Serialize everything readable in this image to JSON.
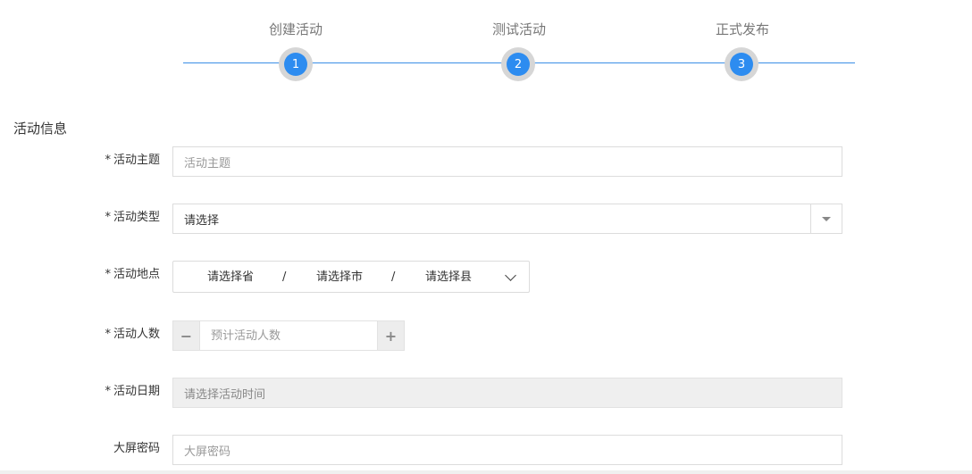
{
  "stepper": {
    "steps": [
      {
        "label": "创建活动",
        "number": "1"
      },
      {
        "label": "测试活动",
        "number": "2"
      },
      {
        "label": "正式发布",
        "number": "3"
      }
    ],
    "accent_color": "#2d8cf0"
  },
  "section_title": "活动信息",
  "form": {
    "required_mark": "*",
    "theme": {
      "label": "活动主题",
      "placeholder": "活动主题"
    },
    "type": {
      "label": "活动类型",
      "value": "请选择",
      "icon": "triangle-down-icon"
    },
    "location": {
      "label": "活动地点",
      "province": "请选择省",
      "city": "请选择市",
      "county": "请选择县",
      "separator": "/",
      "icon": "chevron-down-icon"
    },
    "count": {
      "label": "活动人数",
      "placeholder": "预计活动人数",
      "minus": "−",
      "plus": "+"
    },
    "date": {
      "label": "活动日期",
      "placeholder": "请选择活动时间"
    },
    "password": {
      "label": "大屏密码",
      "placeholder": "大屏密码"
    }
  }
}
